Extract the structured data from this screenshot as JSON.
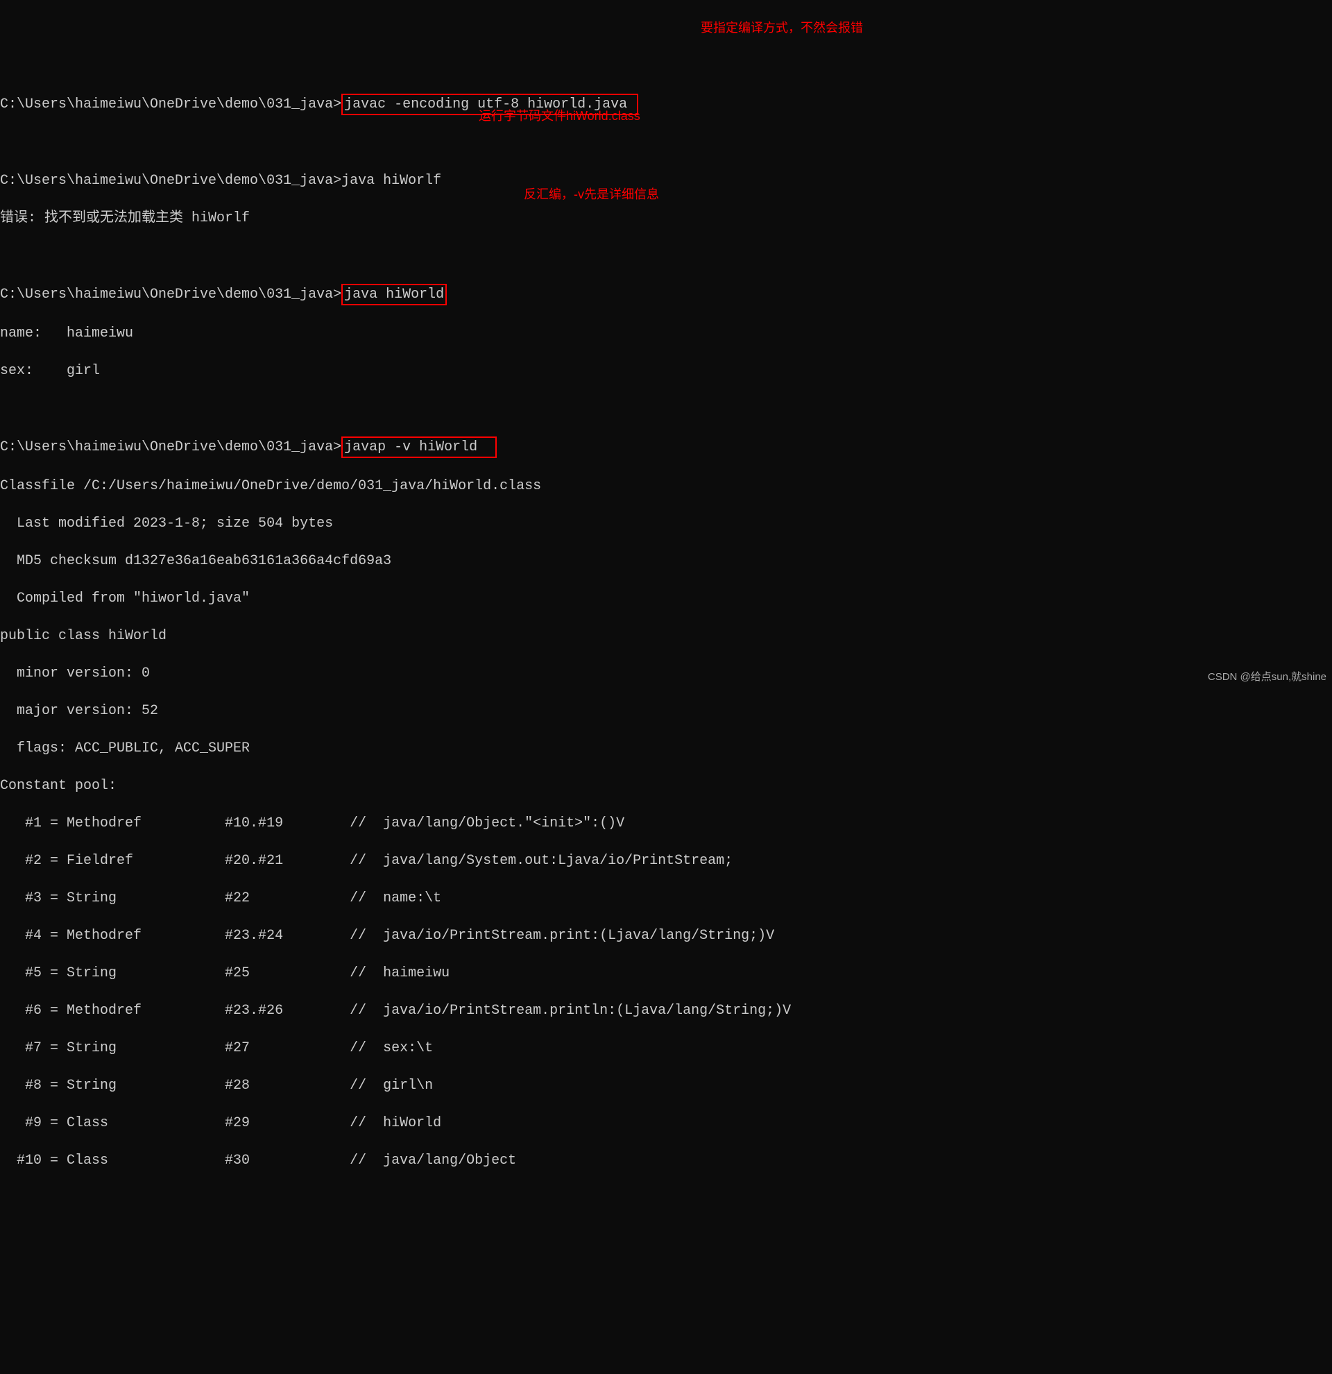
{
  "prompt": "C:\\Users\\haimeiwu\\OneDrive\\demo\\031_java>",
  "cmd1": "javac -encoding utf-8 hiworld.java ",
  "note1": "要指定编译方式，不然会报错",
  "cmd2": "java hiWorlf",
  "err2": "错误: 找不到或无法加载主类 hiWorlf",
  "cmd3": "java hiWorld",
  "note3": "运行字节码文件hiWorld.class",
  "out3a": "name:   haimeiwu",
  "out3b": "sex:    girl",
  "cmd4": "javap -v hiWorld  ",
  "note4": "反汇编，-v先是详细信息",
  "javap": {
    "classfile": "Classfile /C:/Users/haimeiwu/OneDrive/demo/031_java/hiWorld.class",
    "lastmod": "  Last modified 2023-1-8; size 504 bytes",
    "md5": "  MD5 checksum d1327e36a16eab63161a366a4cfd69a3",
    "compiled": "  Compiled from \"hiworld.java\"",
    "decl": "public class hiWorld",
    "minor": "  minor version: 0",
    "major": "  major version: 52",
    "flags": "  flags: ACC_PUBLIC, ACC_SUPER",
    "cphdr": "Constant pool:",
    "cp": [
      "   #1 = Methodref          #10.#19        //  java/lang/Object.\"<init>\":()V",
      "   #2 = Fieldref           #20.#21        //  java/lang/System.out:Ljava/io/PrintStream;",
      "   #3 = String             #22            //  name:\\t",
      "   #4 = Methodref          #23.#24        //  java/io/PrintStream.print:(Ljava/lang/String;)V",
      "   #5 = String             #25            //  haimeiwu",
      "   #6 = Methodref          #23.#26        //  java/io/PrintStream.println:(Ljava/lang/String;)V",
      "   #7 = String             #27            //  sex:\\t",
      "   #8 = String             #28            //  girl\\n",
      "   #9 = Class              #29            //  hiWorld",
      "  #10 = Class              #30            //  java/lang/Object"
    ]
  },
  "watermark": "CSDN @给点sun,就shine"
}
